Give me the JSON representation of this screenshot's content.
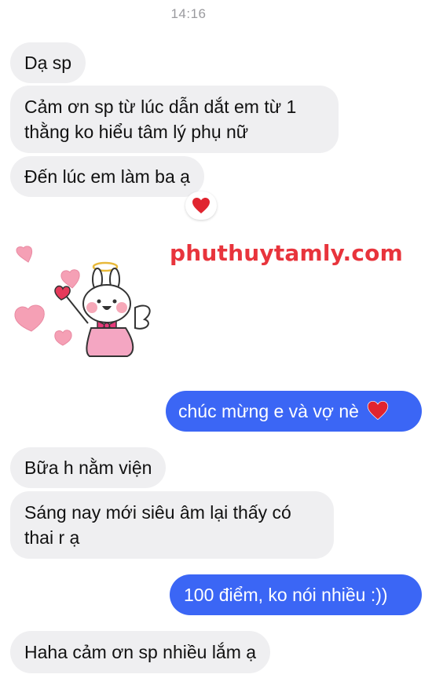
{
  "chat": {
    "timestamp": "14:16",
    "messages": [
      {
        "sender": "them",
        "text": "Dạ sp"
      },
      {
        "sender": "them",
        "line1": "Cảm ơn sp từ lúc dẫn dắt em từ 1",
        "line2": "thằng ko hiểu tâm lý phụ nữ"
      },
      {
        "sender": "them",
        "text": "Đến lúc em làm ba ạ",
        "reaction": "heart"
      },
      {
        "sender": "them",
        "type": "sticker",
        "sticker": "angel-bunny-with-hearts"
      },
      {
        "sender": "me",
        "text": "chúc mừng e và vợ nè",
        "emoji": "heart"
      },
      {
        "sender": "them",
        "text": "Bữa h nằm viện"
      },
      {
        "sender": "them",
        "line1": "Sáng nay mới siêu âm lại thấy có",
        "line2": "thai r ạ"
      },
      {
        "sender": "me",
        "text": "100 điểm, ko nói nhiều :))"
      },
      {
        "sender": "them",
        "text": "Haha cảm ơn sp nhiều lắm ạ"
      }
    ]
  },
  "watermark": "phuthuytamly.com",
  "colors": {
    "incoming_bubble": "#efeff1",
    "outgoing_bubble": "#3b66f5",
    "timestamp": "#9a9a9e",
    "watermark": "#e8343c",
    "heart": "#e0242f"
  }
}
